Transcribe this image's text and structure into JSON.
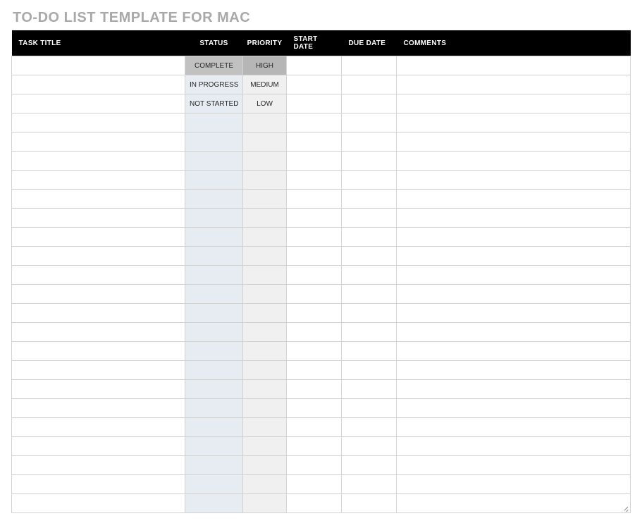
{
  "title": "TO-DO LIST TEMPLATE FOR MAC",
  "columns": {
    "task_title": "TASK TITLE",
    "status": "STATUS",
    "priority": "PRIORITY",
    "start_date": "START DATE",
    "due_date": "DUE DATE",
    "comments": "COMMENTS"
  },
  "status_options": [
    "COMPLETE",
    "IN PROGRESS",
    "NOT STARTED"
  ],
  "priority_options": [
    "HIGH",
    "MEDIUM",
    "LOW"
  ],
  "rows": [
    {
      "task_title": "",
      "status": "COMPLETE",
      "priority": "HIGH",
      "start_date": "",
      "due_date": "",
      "comments": "",
      "shaded": true
    },
    {
      "task_title": "",
      "status": "IN PROGRESS",
      "priority": "MEDIUM",
      "start_date": "",
      "due_date": "",
      "comments": ""
    },
    {
      "task_title": "",
      "status": "NOT STARTED",
      "priority": "LOW",
      "start_date": "",
      "due_date": "",
      "comments": ""
    },
    {
      "task_title": "",
      "status": "",
      "priority": "",
      "start_date": "",
      "due_date": "",
      "comments": ""
    },
    {
      "task_title": "",
      "status": "",
      "priority": "",
      "start_date": "",
      "due_date": "",
      "comments": ""
    },
    {
      "task_title": "",
      "status": "",
      "priority": "",
      "start_date": "",
      "due_date": "",
      "comments": ""
    },
    {
      "task_title": "",
      "status": "",
      "priority": "",
      "start_date": "",
      "due_date": "",
      "comments": ""
    },
    {
      "task_title": "",
      "status": "",
      "priority": "",
      "start_date": "",
      "due_date": "",
      "comments": ""
    },
    {
      "task_title": "",
      "status": "",
      "priority": "",
      "start_date": "",
      "due_date": "",
      "comments": ""
    },
    {
      "task_title": "",
      "status": "",
      "priority": "",
      "start_date": "",
      "due_date": "",
      "comments": ""
    },
    {
      "task_title": "",
      "status": "",
      "priority": "",
      "start_date": "",
      "due_date": "",
      "comments": ""
    },
    {
      "task_title": "",
      "status": "",
      "priority": "",
      "start_date": "",
      "due_date": "",
      "comments": ""
    },
    {
      "task_title": "",
      "status": "",
      "priority": "",
      "start_date": "",
      "due_date": "",
      "comments": ""
    },
    {
      "task_title": "",
      "status": "",
      "priority": "",
      "start_date": "",
      "due_date": "",
      "comments": ""
    },
    {
      "task_title": "",
      "status": "",
      "priority": "",
      "start_date": "",
      "due_date": "",
      "comments": ""
    },
    {
      "task_title": "",
      "status": "",
      "priority": "",
      "start_date": "",
      "due_date": "",
      "comments": ""
    },
    {
      "task_title": "",
      "status": "",
      "priority": "",
      "start_date": "",
      "due_date": "",
      "comments": ""
    },
    {
      "task_title": "",
      "status": "",
      "priority": "",
      "start_date": "",
      "due_date": "",
      "comments": ""
    },
    {
      "task_title": "",
      "status": "",
      "priority": "",
      "start_date": "",
      "due_date": "",
      "comments": ""
    },
    {
      "task_title": "",
      "status": "",
      "priority": "",
      "start_date": "",
      "due_date": "",
      "comments": ""
    },
    {
      "task_title": "",
      "status": "",
      "priority": "",
      "start_date": "",
      "due_date": "",
      "comments": ""
    },
    {
      "task_title": "",
      "status": "",
      "priority": "",
      "start_date": "",
      "due_date": "",
      "comments": ""
    },
    {
      "task_title": "",
      "status": "",
      "priority": "",
      "start_date": "",
      "due_date": "",
      "comments": ""
    },
    {
      "task_title": "",
      "status": "",
      "priority": "",
      "start_date": "",
      "due_date": "",
      "comments": ""
    }
  ]
}
